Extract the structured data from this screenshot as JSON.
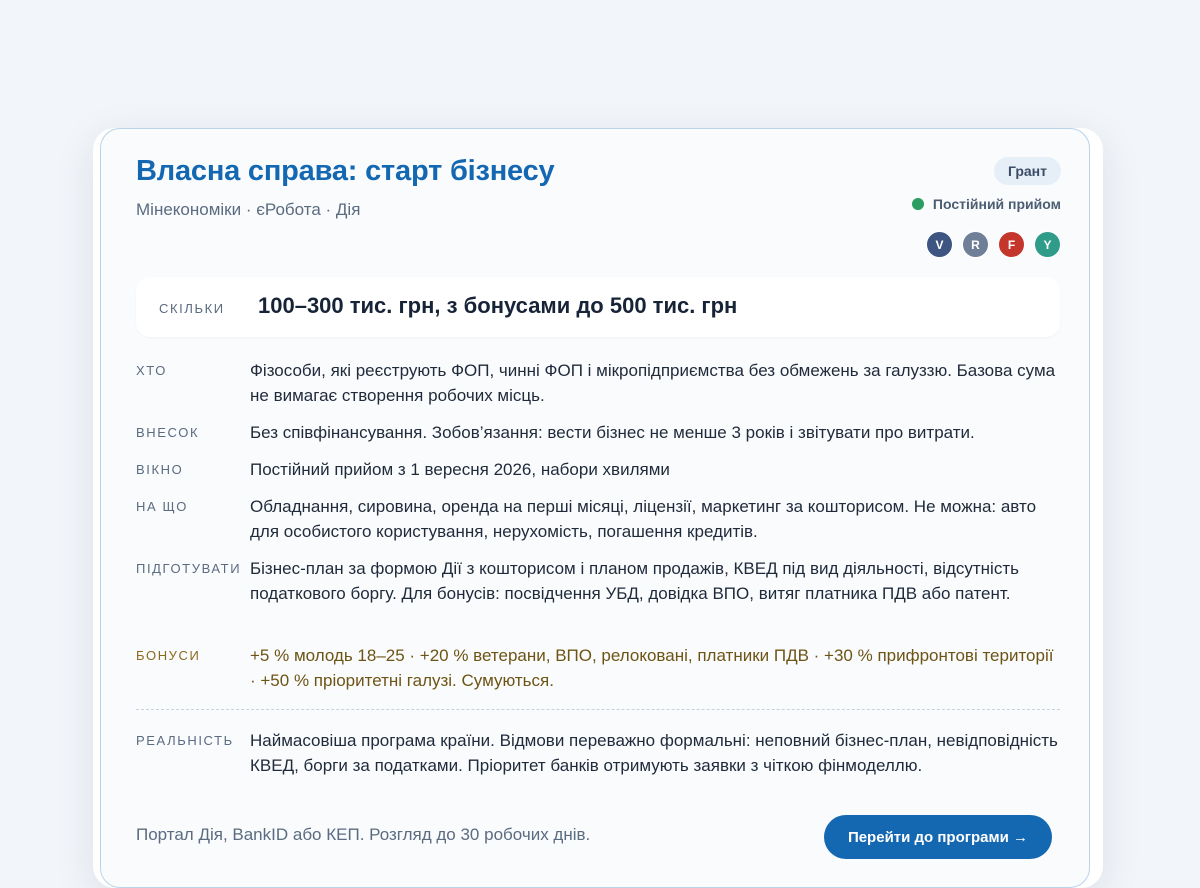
{
  "program": {
    "title": "Власна справа: старт бізнесу",
    "subtitle": "Мінекономіки · єРобота · Дія",
    "badge": "Грант",
    "status": "Постійний прийом",
    "colors": {
      "accent": "#1467b1",
      "status_ok": "#2a9d62",
      "bonus": "#6e5414"
    },
    "avatars": [
      {
        "letter": "V",
        "color": "#3d5580"
      },
      {
        "letter": "R",
        "color": "#6f7f98"
      },
      {
        "letter": "F",
        "color": "#c4362c"
      },
      {
        "letter": "Y",
        "color": "#2f9c8a"
      }
    ]
  },
  "amount": {
    "label": "СКІЛЬКИ",
    "value": "100–300 тис. грн, з бонусами до 500 тис. грн"
  },
  "details": [
    {
      "label": "ХТО",
      "text": "Фізособи, які реєструють ФОП, чинні ФОП і мікропідприємства без обмежень за галуззю. Базова сума не вимагає створення робочих місць."
    },
    {
      "label": "ВНЕСОК",
      "text": "Без співфінансування. Зобов’язання: вести бізнес не менше 3 років і звітувати про витрати."
    },
    {
      "label": "ВІКНО",
      "text": "Постійний прийом з 1 вересня 2026, набори хвилями"
    },
    {
      "label": "НА ЩО",
      "text": "Обладнання, сировина, оренда на перші місяці, ліцензії, маркетинг за кошторисом. Не можна: авто для особистого користування, нерухомість, погашення кредитів."
    },
    {
      "label": "ПІДГОТУВАТИ",
      "text": "Бізнес-план за формою Дії з кошторисом і планом продажів, КВЕД під вид діяльності, відсутність податкового боргу. Для бонусів: посвідчення УБД, довідка ВПО, витяг платника ПДВ або патент."
    },
    {
      "label": "БОНУСИ",
      "text": "+5 % молодь 18–25 · +20 % ветерани, ВПО, релоковані, платники ПДВ · +30 % прифронтові території · +50 % пріоритетні галузі. Сумуються."
    },
    {
      "label": "РЕАЛЬНІСТЬ",
      "text": "Наймасовіша програма країни. Відмови переважно формальні: неповний бізнес-план, невідповідність КВЕД, борги за податками. Пріоритет банків отримують заявки з чіткою фінмоделлю."
    }
  ],
  "footer": {
    "text": "Портал Дія, BankID або КЕП. Розгляд до 30 робочих днів.",
    "cta": "Перейти до програми →"
  }
}
